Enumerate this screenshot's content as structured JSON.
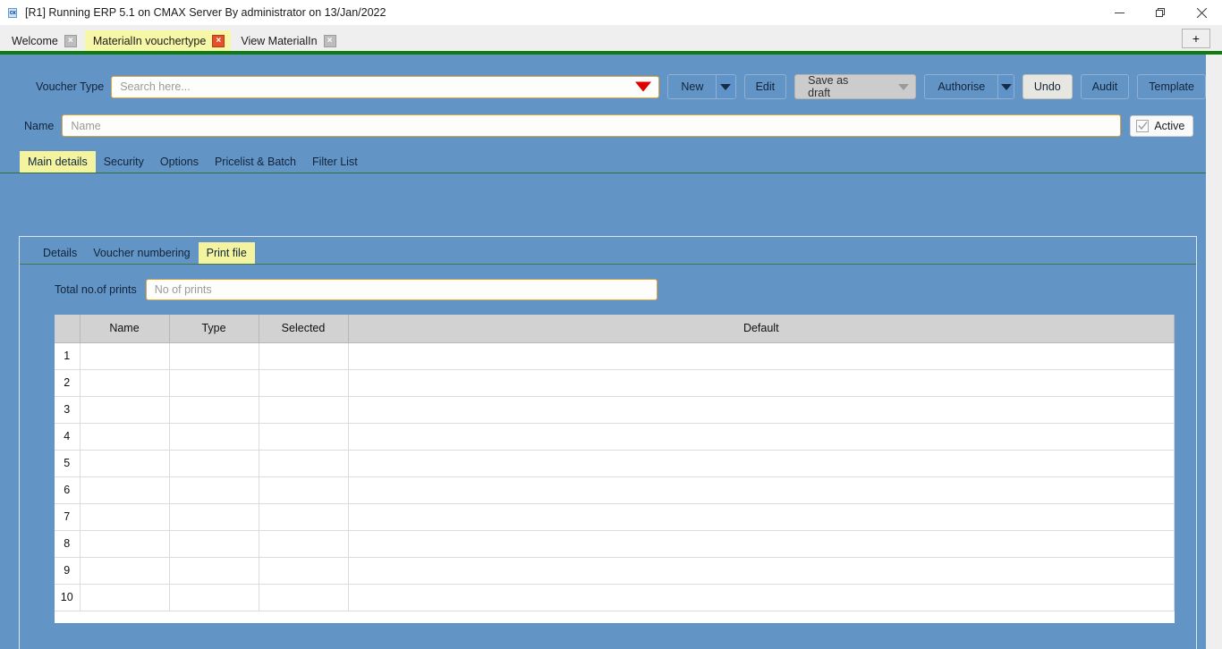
{
  "window": {
    "title": "[R1] Running ERP 5.1 on CMAX Server By administrator on 13/Jan/2022",
    "icon": "app-icon",
    "minimize_label": "Minimize",
    "restore_label": "Restore",
    "close_label": "Close"
  },
  "doc_tabs": [
    {
      "label": "Welcome",
      "active": false,
      "close": "×"
    },
    {
      "label": "MaterialIn vouchertype",
      "active": true,
      "close": "×"
    },
    {
      "label": "View MaterialIn",
      "active": false,
      "close": "×"
    }
  ],
  "new_tab_label": "+",
  "toolbar": {
    "voucher_type_label": "Voucher Type",
    "search_placeholder": "Search here...",
    "search_value": "",
    "new_label": "New",
    "edit_label": "Edit",
    "save_as_draft_label": "Save as draft",
    "authorise_label": "Authorise",
    "undo_label": "Undo",
    "audit_label": "Audit",
    "template_label": "Template"
  },
  "name_row": {
    "label": "Name",
    "placeholder": "Name",
    "value": "",
    "active_label": "Active",
    "active_checked": true
  },
  "tabs_level1": [
    {
      "label": "Main details",
      "active": true
    },
    {
      "label": "Security",
      "active": false
    },
    {
      "label": "Options",
      "active": false
    },
    {
      "label": "Pricelist & Batch",
      "active": false
    },
    {
      "label": "Filter List",
      "active": false
    }
  ],
  "tabs_level2": [
    {
      "label": "Details",
      "active": false
    },
    {
      "label": "Voucher numbering",
      "active": false
    },
    {
      "label": "Print file",
      "active": true
    }
  ],
  "print_file": {
    "total_prints_label": "Total no.of prints",
    "total_prints_placeholder": "No of prints",
    "total_prints_value": ""
  },
  "grid": {
    "columns": [
      "",
      "Name",
      "Type",
      "Selected",
      "Default"
    ],
    "rows": [
      {
        "num": "1",
        "name": "",
        "type": "",
        "selected": "",
        "default": ""
      },
      {
        "num": "2",
        "name": "",
        "type": "",
        "selected": "",
        "default": ""
      },
      {
        "num": "3",
        "name": "",
        "type": "",
        "selected": "",
        "default": ""
      },
      {
        "num": "4",
        "name": "",
        "type": "",
        "selected": "",
        "default": ""
      },
      {
        "num": "5",
        "name": "",
        "type": "",
        "selected": "",
        "default": ""
      },
      {
        "num": "6",
        "name": "",
        "type": "",
        "selected": "",
        "default": ""
      },
      {
        "num": "7",
        "name": "",
        "type": "",
        "selected": "",
        "default": ""
      },
      {
        "num": "8",
        "name": "",
        "type": "",
        "selected": "",
        "default": ""
      },
      {
        "num": "9",
        "name": "",
        "type": "",
        "selected": "",
        "default": ""
      },
      {
        "num": "10",
        "name": "",
        "type": "",
        "selected": "",
        "default": ""
      }
    ]
  },
  "colors": {
    "body_blue": "#6394c6",
    "accent_yellow": "#f3f3a0",
    "field_border": "#e0a33a",
    "rule_green": "#107c10",
    "caret_red": "#e00000",
    "tab_close_active": "#e8502a"
  }
}
